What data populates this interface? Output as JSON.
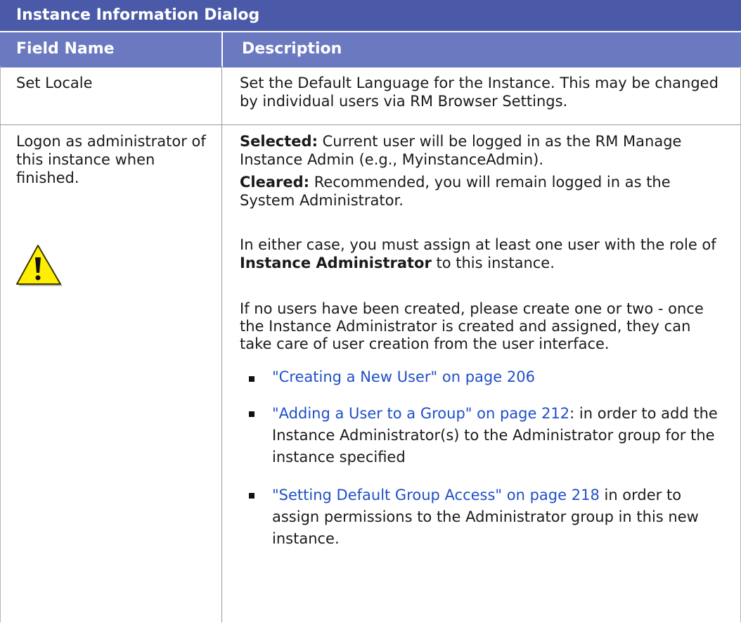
{
  "table": {
    "title": "Instance Information Dialog",
    "headers": {
      "field": "Field Name",
      "description": "Description"
    },
    "rows": [
      {
        "field": "Set Locale",
        "description": "Set the Default Language for the Instance. This may be changed by individual users via RM Browser Settings."
      },
      {
        "field": "Logon as administrator of this instance when finished.",
        "selected_label": "Selected:",
        "selected_text": " Current user will be logged in as the RM Manage Instance Admin (e.g., MyinstanceAdmin).",
        "cleared_label": "Cleared:",
        "cleared_text": " Recommended, you will remain logged in as the System Administrator.",
        "either_pre": "In either case, you must assign at least one user with the role of ",
        "either_bold": "Instance Administrator",
        "either_post": " to this instance.",
        "no_users": "If no users have been created, please create one or two - once the Instance Administrator is created and assigned, they can take care of user creation from the user interface.",
        "links": [
          {
            "link": "\"Creating a New User\" on page 206",
            "after": ""
          },
          {
            "link": "\"Adding a User to a Group\" on page 212",
            "after": ": in order to add the Instance Administrator(s) to the Administrator group for the instance specified"
          },
          {
            "link": "\"Setting Default Group Access\" on page 218",
            "after": " in order to assign permissions to the Administrator group in this new instance."
          }
        ],
        "icon": "warning-icon"
      }
    ]
  },
  "colors": {
    "title_bg": "#4a5aa8",
    "header_bg": "#6b79c0",
    "link": "#1f4fc7",
    "warning_fill": "#ffee00"
  }
}
